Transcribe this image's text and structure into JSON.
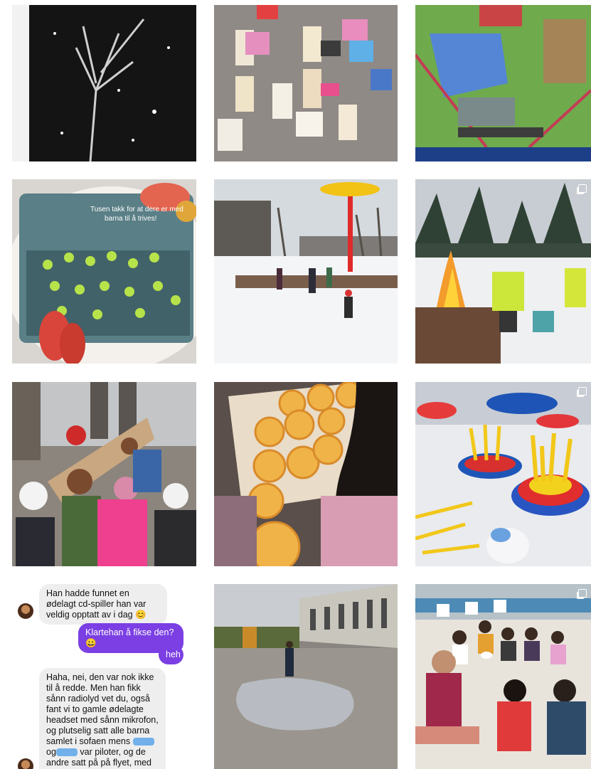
{
  "grid": {
    "tiles": [
      {
        "label": "black-canvas-tree-painting"
      },
      {
        "label": "paper-doll-drawings-on-board"
      },
      {
        "label": "minecraft-screen"
      },
      {
        "label": "cake-with-photo-print"
      },
      {
        "label": "kids-sledding-snow"
      },
      {
        "label": "campfire-in-snow"
      },
      {
        "label": "group-of-children-cheering"
      },
      {
        "label": "homemade-pizzas"
      },
      {
        "label": "clay-sculptures"
      },
      {
        "label": "chat-conversation"
      },
      {
        "label": "child-in-puddle-schoolyard"
      },
      {
        "label": "children-drum-circle"
      }
    ]
  },
  "cake": {
    "text_line1": "Tusen takk for at dere er med",
    "text_line2": "barna til å trives!"
  },
  "chat": {
    "msg1": "Han hadde funnet en ødelagt cd-spiller han var veldig opptatt av i dag 😊",
    "msg2": "Klartehan å fikse den? 😀",
    "msg3": "heh",
    "msg4_a": "Haha, nei, den var nok ikke til å redde. Men han fikk sånn radiolyd vet du, også fant vi to gamle ødelagte headset med sånn mikrofon, og plutselig satt alle barna samlet i sofaen mens",
    "msg4_og1": "og",
    "msg4_b": "var piloter, og de andre satt på på flyet, med flystøy og greier. Det var et morsomt syn!"
  },
  "colors": {
    "chat_out": "#7b3fe4",
    "chat_in": "#eeeeef",
    "redact": "#5aa5e8"
  }
}
